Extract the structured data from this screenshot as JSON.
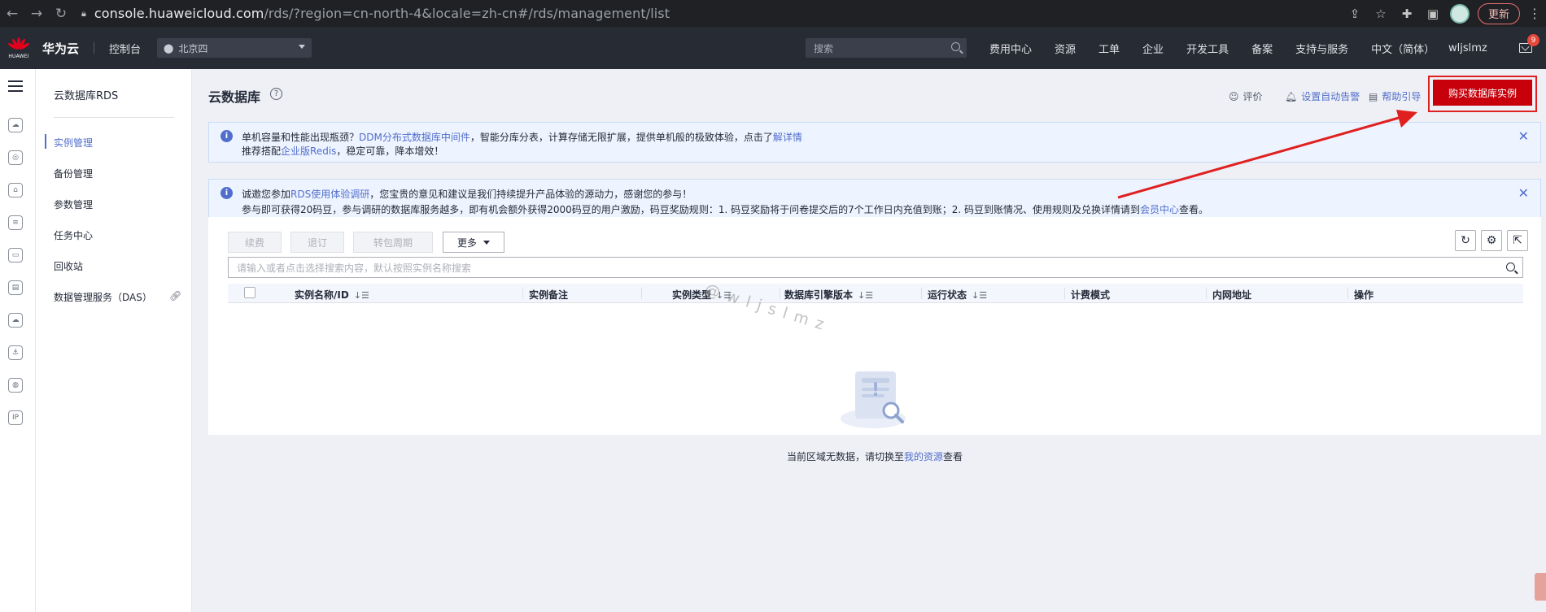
{
  "browser": {
    "url_host": "console.huaweicloud.com",
    "url_path": "/rds/?region=cn-north-4&locale=zh-cn#/rds/management/list",
    "update_label": "更新"
  },
  "topbar": {
    "logo_text": "HUAWEI",
    "brand": "华为云",
    "console": "控制台",
    "region": "北京四",
    "search_placeholder": "搜索",
    "nav": [
      "费用中心",
      "资源",
      "工单",
      "企业",
      "开发工具",
      "备案",
      "支持与服务",
      "中文（简体）"
    ],
    "user": "wljslmz",
    "mail_badge": "9"
  },
  "submenu": {
    "title": "云数据库RDS",
    "items": [
      {
        "label": "实例管理"
      },
      {
        "label": "备份管理"
      },
      {
        "label": "参数管理"
      },
      {
        "label": "任务中心"
      },
      {
        "label": "回收站"
      },
      {
        "label": "数据管理服务（DAS）"
      }
    ]
  },
  "header": {
    "title": "云数据库",
    "rate": "评价",
    "alarm": "设置自动告警",
    "guide": "帮助引导",
    "buy": "购买数据库实例"
  },
  "notice1": {
    "l1_a": "单机容量和性能出现瓶颈？",
    "l1_link1": "DDM分布式数据库中间件",
    "l1_b": "，智能分库分表，计算存储无限扩展，提供单机般的极致体验，点击了",
    "l1_link2": "解详情",
    "l2_a": "推荐搭配",
    "l2_link": "企业版Redis",
    "l2_b": "，稳定可靠，降本增效！"
  },
  "notice2": {
    "l1_a": "诚邀您参加",
    "l1_link": "RDS使用体验调研",
    "l1_b": "，您宝贵的意见和建议是我们持续提升产品体验的源动力，感谢您的参与！",
    "l2_a": "参与即可获得20码豆，参与调研的数据库服务越多，即有机会额外获得2000码豆的用户激励，码豆奖励规则：1. 码豆奖励将于问卷提交后的7个工作日内充值到账；2. 码豆到账情况、使用规则及兑换详情请到",
    "l2_link": "会员中心",
    "l2_b": "查看。"
  },
  "toolbar": {
    "renew": "续费",
    "unsubscribe": "退订",
    "to_monthly": "转包周期",
    "more": "更多"
  },
  "search": {
    "placeholder": "请输入或者点击选择搜索内容，默认按照实例名称搜索"
  },
  "table": {
    "columns": [
      "实例名称/ID",
      "实例备注",
      "实例类型",
      "数据库引擎版本",
      "运行状态",
      "计费模式",
      "内网地址",
      "操作"
    ],
    "rows": []
  },
  "empty": {
    "text_a": "当前区域无数据，请切换至",
    "link": "我的资源",
    "text_b": "查看"
  },
  "watermark": "@wljslmz"
}
